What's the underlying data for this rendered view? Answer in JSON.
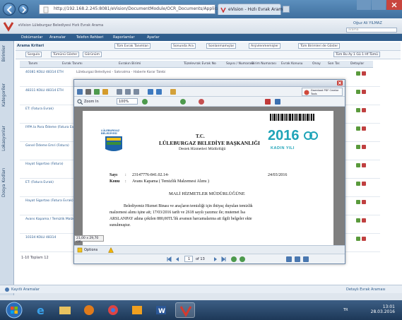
{
  "browser": {
    "url": "http://192.168.2.245:8081/eVision/DocumentModule/OCR_Documents/Application/?DOCID=...",
    "tabs": [
      {
        "label": "eVision - Hızlı Evrak Arama"
      }
    ],
    "title": "eVision - Hızlı Evrak Arama"
  },
  "app": {
    "header_left": "eVision  Lüleburgaz Belediyesi  Hızlı Evrak Arama",
    "header_right": "Oğuz Ali YILMAZ",
    "menu": [
      "Dokümanlar",
      "Aramalar",
      "Telefon Rehberi",
      "Raporlamlar",
      "Ayarlar"
    ],
    "search_box_value": "arama",
    "sidebar": [
      "Birimler",
      "Kategoriler",
      "Lokasyonlar",
      "Dosya Kodları"
    ],
    "filter": {
      "label": "Arama Kriteri",
      "chip1": "Tüm Evrak Tanımları",
      "chip2": "Sonunda Ara",
      "chip3": "Sonlanmamışlar",
      "chip4": "Arşivlenmemişler",
      "chip5": "Tüm Birimleri de Göster"
    },
    "toolbar": {
      "btn1": "Sorgula",
      "btn2": "Tümünü Göster",
      "btn3": "Görünüm",
      "right": "Tüm  Bu  Ay  1 Gü  1 Hf  Tümü"
    },
    "grid": {
      "headers": [
        "Tanım",
        "Evrak Tanımı",
        "Evrakın Birimi",
        "Tüzelevrak Evrak No",
        "Sayısı / Numarası",
        "Birim Numarası",
        "Evrak Konusu",
        "Onay",
        "Son Tar.",
        "Detaylar"
      ],
      "rows": [
        {
          "name": "40381 KOLU 48314 ETH",
          "desc": "Lüleburgaz Belediyesi - Satınalma - Haberle Karar Talebi"
        },
        {
          "name": "48311 KOLU 48314 ETH",
          "desc": ""
        },
        {
          "name": "ET: (Fatura Evrak)",
          "desc": ""
        },
        {
          "name": "IYPA la Para Ödeme (Fatura Evrak)",
          "desc": ""
        },
        {
          "name": "Genel Ödeme Emri (Fatura)",
          "desc": ""
        },
        {
          "name": "Hayat Sigortası (Fatura)",
          "desc": ""
        },
        {
          "name": "ET: (Fatura Evrak)",
          "desc": ""
        },
        {
          "name": "Hayat Sigortası (Fatura Evrak)",
          "desc": ""
        },
        {
          "name": "Avans Kapama / Temizlik Malzemesi",
          "desc": ""
        },
        {
          "name": "10334 KOLU 48314",
          "desc": ""
        }
      ],
      "footer": "1-10 Toplam 12"
    },
    "status_left": "Kayıtlı Aramalar",
    "status_right": "Detaylı Evrak Araması"
  },
  "viewer": {
    "zoom_label": "Zoom In",
    "zoom_value": "100%",
    "download_label": "Download PDF Creator Tools",
    "page_size": "21,00 x 29,70 cm",
    "options_label": "Options",
    "page_current": "1",
    "page_total": "of 13"
  },
  "document": {
    "org_small": "LÜLEBURGAZ BELEDİYESİ",
    "republic": "T.C.",
    "institution": "LÜLEBURGAZ BELEDİYE BAŞKANLIĞI",
    "unit": "Destek Hizmetleri Müdürlüğü",
    "year_logo": "2016",
    "logo_sub": "KADIN YILI",
    "sayi_label": "Sayı",
    "sayi_value": "23147776-841.02.14-",
    "konu_label": "Konu",
    "konu_value": "Avans Kapama ( Temizlik Malzemesi Alımı )",
    "date": "24/03/2016",
    "recipient": "MALİ HİZMETLER MÜDÜRLÜĞÜNE",
    "body1": "Belediyemiz Hizmet Binası ve araçların temizliği için ihtiyaç duyulan temizlik",
    "body2": "malzemesi alımı işine ait; 17/03/2016 tarih ve 2618 sayılı yazımız ile; mutemet İsa",
    "body3": "ARSLANPAY adına çekilen 880,00TL'lik avansın harcamalarına ait ilgili belgeler ekte",
    "body4": "sunulmuştur."
  },
  "taskbar": {
    "time": "13:01",
    "date": "28.03.2016",
    "lang": "TR"
  }
}
